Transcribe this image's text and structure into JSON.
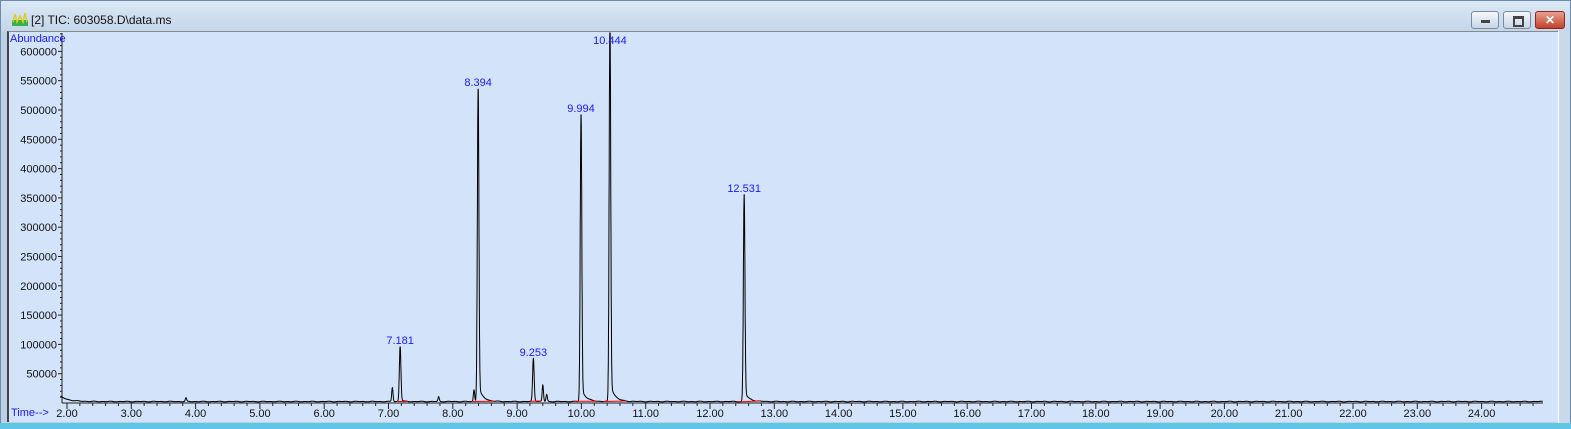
{
  "window": {
    "title": "[2] TIC: 603058.D\\data.ms",
    "icon": "chromatogram-icon",
    "buttons": {
      "minimize": "minimize-icon",
      "maximize": "maximize-icon",
      "close": "close-icon"
    }
  },
  "chart_data": {
    "type": "line",
    "title": "",
    "xlabel": "Time-->",
    "ylabel": "Abundance",
    "xlim": [
      1.9,
      24.95
    ],
    "ylim": [
      0,
      631000
    ],
    "grid": false,
    "x_ticks": [
      "2.00",
      "3.00",
      "4.00",
      "5.00",
      "6.00",
      "7.00",
      "8.00",
      "9.00",
      "10.00",
      "11.00",
      "12.00",
      "13.00",
      "14.00",
      "15.00",
      "16.00",
      "17.00",
      "18.00",
      "19.00",
      "20.00",
      "21.00",
      "22.00",
      "23.00",
      "24.00"
    ],
    "y_ticks": [
      "50000",
      "100000",
      "150000",
      "200000",
      "250000",
      "300000",
      "350000",
      "400000",
      "450000",
      "500000",
      "550000",
      "600000"
    ],
    "labeled_peaks": [
      {
        "label": "7.181",
        "rt": 7.181,
        "abundance": 94000
      },
      {
        "label": "8.394",
        "rt": 8.394,
        "abundance": 534000
      },
      {
        "label": "9.253",
        "rt": 9.253,
        "abundance": 73000
      },
      {
        "label": "9.994",
        "rt": 9.994,
        "abundance": 490000
      },
      {
        "label": "10.444",
        "rt": 10.444,
        "abundance": 650000
      },
      {
        "label": "12.531",
        "rt": 12.531,
        "abundance": 353000
      }
    ],
    "minor_peaks": [
      {
        "rt": 3.85,
        "abundance": 6000
      },
      {
        "rt": 7.06,
        "abundance": 24000
      },
      {
        "rt": 7.78,
        "abundance": 8000
      },
      {
        "rt": 8.33,
        "abundance": 20000
      },
      {
        "rt": 9.4,
        "abundance": 28000
      },
      {
        "rt": 9.46,
        "abundance": 12000
      }
    ],
    "trace_color": "#000000",
    "integration_baseline_color": "#ff0000",
    "label_color": "#1a1aff",
    "background_color": "#d3e3fa"
  }
}
